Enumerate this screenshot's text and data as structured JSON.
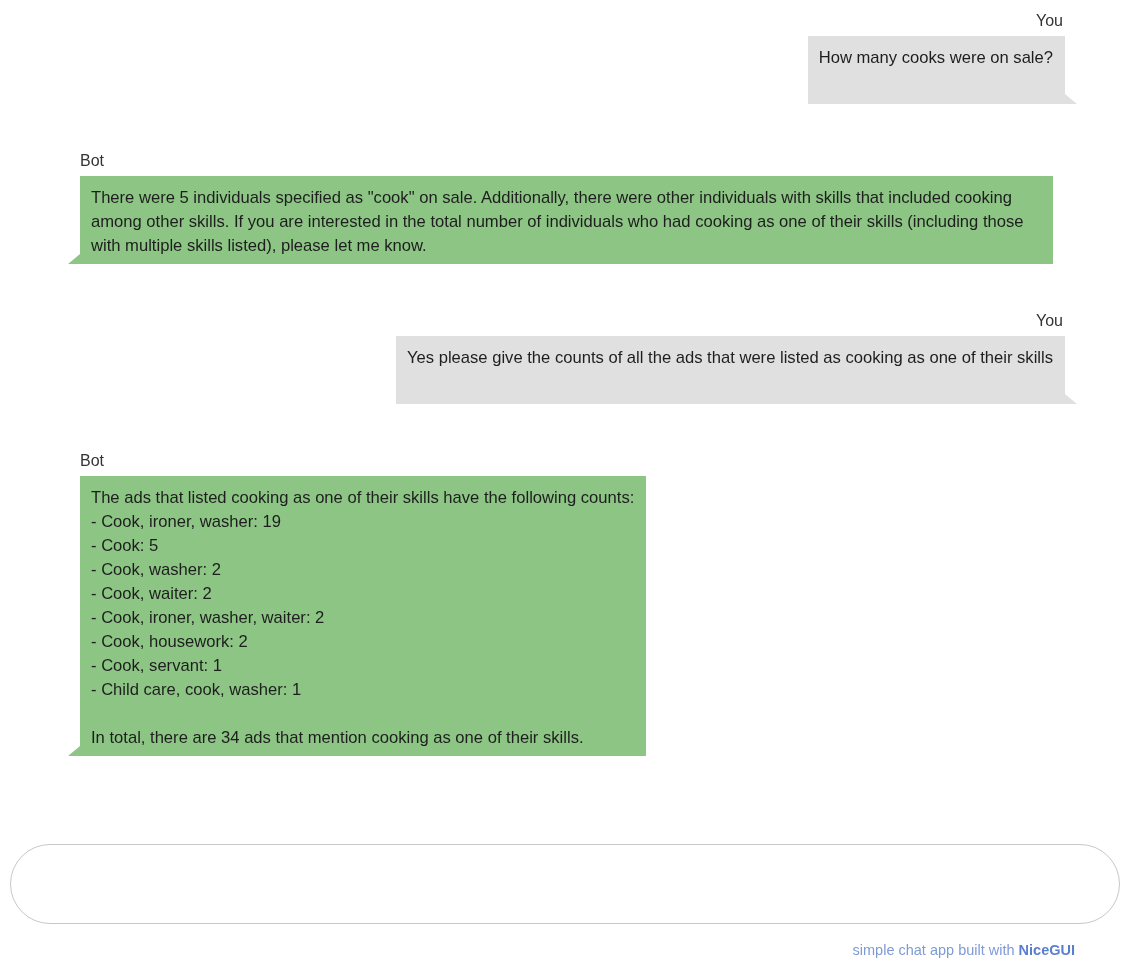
{
  "messages": [
    {
      "sender": "You",
      "kind": "sent",
      "text": "How many cooks were on sale?"
    },
    {
      "sender": "Bot",
      "kind": "received",
      "text": "There were 5 individuals specified as \"cook\" on sale. Additionally, there were other individuals with skills that included cooking among other skills. If you are interested in the total number of individuals who had cooking as one of their skills (including those with multiple skills listed), please let me know."
    },
    {
      "sender": "You",
      "kind": "sent",
      "text": "Yes please give the counts of all the ads that were listed as cooking as one of their skills"
    },
    {
      "sender": "Bot",
      "kind": "received",
      "text": "The ads that listed cooking as one of their skills have the following counts:\n- Cook, ironer, washer: 19\n- Cook: 5\n- Cook, washer: 2\n- Cook, waiter: 2\n- Cook, ironer, washer, waiter: 2\n- Cook, housework: 2\n- Cook, servant: 1\n- Child care, cook, washer: 1\n\nIn total, there are 34 ads that mention cooking as one of their skills."
    }
  ],
  "footer": {
    "text": "simple chat app built with",
    "link": "NiceGUI"
  }
}
